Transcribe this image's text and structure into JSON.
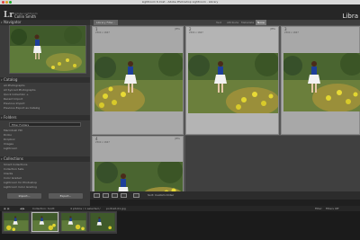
{
  "window": {
    "title": "Lightroom 6.lrcat - Adobe Photoshop Lightroom - Library"
  },
  "identity": {
    "subtitle": "Adobe Lightroom",
    "name": "Collin Smith",
    "module": "Libra",
    "logo": "Lr"
  },
  "navigator": {
    "title": "Navigator"
  },
  "catalog": {
    "title": "Catalog",
    "items": [
      {
        "label": "All Photographs",
        "count": ""
      },
      {
        "label": "All Synced Photographs",
        "count": ""
      },
      {
        "label": "Quick Collection +",
        "count": ""
      },
      {
        "label": "Recent Import",
        "count": ""
      },
      {
        "label": "Previous Import",
        "count": ""
      },
      {
        "label": "Previous Export as Catalog",
        "count": ""
      }
    ]
  },
  "folders": {
    "title": "Folders",
    "search_placeholder": "Filter Folders",
    "items": [
      {
        "label": "Macintosh HD",
        "count": ""
      },
      {
        "label": "Drobo",
        "count": ""
      },
      {
        "label": "Dropbox",
        "count": ""
      },
      {
        "label": "Images",
        "count": ""
      },
      {
        "label": "Lightroom",
        "count": ""
      }
    ]
  },
  "collections": {
    "title": "Collections",
    "items": [
      {
        "label": "Smart Collections",
        "count": ""
      },
      {
        "label": "Collection Sets",
        "count": ""
      },
      {
        "label": "Clients",
        "count": ""
      },
      {
        "label": "Color Graded",
        "count": ""
      },
      {
        "label": "Lightroom for Photoshop",
        "count": ""
      },
      {
        "label": "Lightroom Color Grading",
        "count": ""
      }
    ]
  },
  "left_buttons": {
    "import": "Import...",
    "export": "Export..."
  },
  "grid": {
    "library_label": "Library Filter :",
    "filters": [
      "Text",
      "Attribute",
      "Metadata",
      "None"
    ],
    "active_filter": "None",
    "cells": [
      {
        "num": "1",
        "meta": "2500 x 1667",
        "fname": "JPEG"
      },
      {
        "num": "2",
        "meta": "2500 x 1667",
        "fname": "JPEG"
      },
      {
        "num": "3",
        "meta": "2500 x 1667",
        "fname": "JPEG"
      },
      {
        "num": "4",
        "meta": "2500 x 1667",
        "fname": "JPEG"
      }
    ]
  },
  "toolbar": {
    "sort_label": "Sort: Custom Order"
  },
  "filmstrip": {
    "source": "Collection: Scott",
    "status": "4 photos / 1 selected / ",
    "filename": "portrait-01.jpg",
    "filter_label": "Filter:",
    "filter_value": "Filters Off"
  }
}
